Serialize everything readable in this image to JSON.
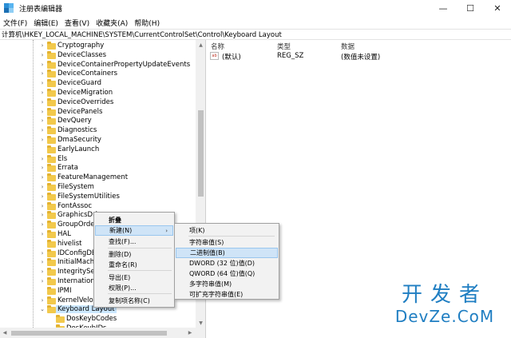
{
  "window": {
    "title": "注册表编辑器",
    "minimize_glyph": "—",
    "maximize_glyph": "☐",
    "close_glyph": "✕"
  },
  "menubar": [
    "文件(F)",
    "编辑(E)",
    "查看(V)",
    "收藏夹(A)",
    "帮助(H)"
  ],
  "address": "计算机\\HKEY_LOCAL_MACHINE\\SYSTEM\\CurrentControlSet\\Control\\Keyboard Layout",
  "tree": {
    "items": [
      {
        "label": "Cryptography",
        "expandable": true
      },
      {
        "label": "DeviceClasses",
        "expandable": true
      },
      {
        "label": "DeviceContainerPropertyUpdateEvents",
        "expandable": true
      },
      {
        "label": "DeviceContainers",
        "expandable": true
      },
      {
        "label": "DeviceGuard",
        "expandable": true
      },
      {
        "label": "DeviceMigration",
        "expandable": true
      },
      {
        "label": "DeviceOverrides",
        "expandable": true
      },
      {
        "label": "DevicePanels",
        "expandable": true
      },
      {
        "label": "DevQuery",
        "expandable": true
      },
      {
        "label": "Diagnostics",
        "expandable": true
      },
      {
        "label": "DmaSecurity",
        "expandable": true
      },
      {
        "label": "EarlyLaunch",
        "expandable": false
      },
      {
        "label": "Els",
        "expandable": true
      },
      {
        "label": "Errata",
        "expandable": true
      },
      {
        "label": "FeatureManagement",
        "expandable": true
      },
      {
        "label": "FileSystem",
        "expandable": true
      },
      {
        "label": "FileSystemUtilities",
        "expandable": true
      },
      {
        "label": "FontAssoc",
        "expandable": true
      },
      {
        "label": "GraphicsDri",
        "expandable": true
      },
      {
        "label": "GroupOrde",
        "expandable": true
      },
      {
        "label": "HAL",
        "expandable": true
      },
      {
        "label": "hivelist",
        "expandable": false
      },
      {
        "label": "IDConfigDB",
        "expandable": true
      },
      {
        "label": "InitialMachi",
        "expandable": true
      },
      {
        "label": "IntegritySe",
        "expandable": true
      },
      {
        "label": "Internationa",
        "expandable": true
      },
      {
        "label": "IPMI",
        "expandable": false
      },
      {
        "label": "KernelVeloc",
        "expandable": true
      },
      {
        "label": "Keyboard Layout",
        "expandable": true,
        "expanded": true,
        "selected": true
      },
      {
        "label": "DosKeybCodes",
        "expandable": false,
        "child": true
      },
      {
        "label": "DosKeybIDs",
        "expandable": false,
        "child": true
      }
    ]
  },
  "list": {
    "headers": {
      "name": "名称",
      "type": "类型",
      "data": "数据"
    },
    "rows": [
      {
        "icon": "ab",
        "name": "(默认)",
        "type": "REG_SZ",
        "data": "(数值未设置)"
      }
    ]
  },
  "context_menu": {
    "items": [
      {
        "label": "折叠",
        "bold": true
      },
      {
        "label": "新建(N)",
        "submenu": true,
        "highlight": true,
        "arrow": "›"
      },
      {
        "label": "查找(F)..."
      },
      {
        "label": "删除(D)"
      },
      {
        "label": "重命名(R)"
      },
      {
        "label": "导出(E)"
      },
      {
        "label": "权限(P)..."
      },
      {
        "label": "复制项名称(C)"
      }
    ]
  },
  "submenu": {
    "items": [
      {
        "label": "项(K)"
      },
      {
        "label": "字符串值(S)"
      },
      {
        "label": "二进制值(B)",
        "highlight": true
      },
      {
        "label": "DWORD (32 位)值(D)"
      },
      {
        "label": "QWORD (64 位)值(Q)"
      },
      {
        "label": "多字符串值(M)"
      },
      {
        "label": "可扩充字符串值(E)"
      }
    ]
  },
  "watermark": {
    "cn": "开发者",
    "en": "DevZe.CoM"
  },
  "colors": {
    "selection": "#cce8ff",
    "folder": "#f2c94c",
    "watermark": "#1f7ec2"
  }
}
